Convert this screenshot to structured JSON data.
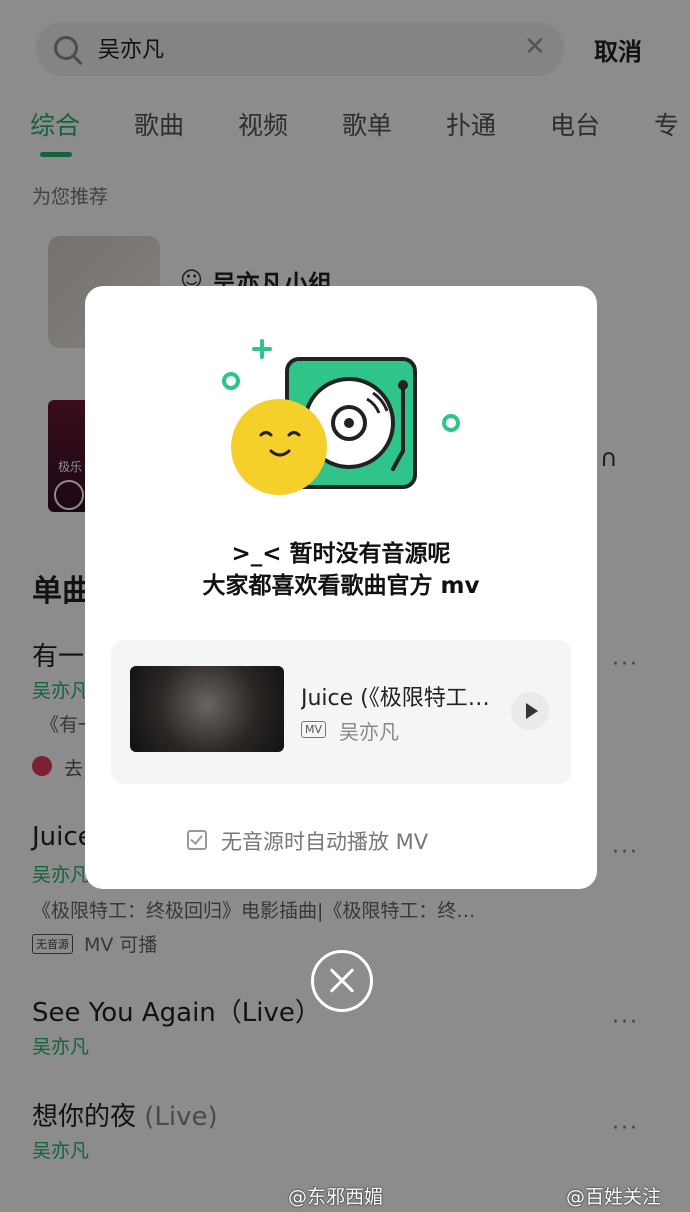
{
  "search": {
    "query": "吴亦凡",
    "cancel_label": "取消"
  },
  "tabs": [
    "综合",
    "歌曲",
    "视频",
    "歌单",
    "扑通",
    "电台",
    "专"
  ],
  "recommend": {
    "title": "为您推荐",
    "group_name": "吴亦凡小组",
    "thumb_text": "极乐"
  },
  "songs_section": {
    "title": "单曲"
  },
  "songs": [
    {
      "title": "有一",
      "artist": "吴亦凡",
      "sub": "《有一",
      "goto": "去"
    },
    {
      "title": "Juice",
      "artist": "吴亦凡",
      "sub": "《极限特工：终极回归》电影插曲|《极限特工：终…",
      "tag": "无音源",
      "tag_text": "MV 可播"
    },
    {
      "title": "See You Again（Live）",
      "artist": "吴亦凡"
    },
    {
      "title": "想你的夜",
      "title_suffix": "(Live)",
      "artist": "吴亦凡"
    }
  ],
  "more_label": "···",
  "modal": {
    "line1": ">_< 暂时没有音源呢",
    "line2": "大家都喜欢看歌曲官方 mv",
    "mv": {
      "title": "Juice (《极限特工：终极回归》电影插曲)",
      "tag": "MV",
      "artist": "吴亦凡"
    },
    "checkbox_label": "无音源时自动播放 MV"
  },
  "watermarks": [
    "@东邪西媚",
    "@百姓关注"
  ],
  "colors": {
    "accent": "#21b66a",
    "illustration_green": "#2ec48a",
    "sun_yellow": "#f6d02a"
  },
  "icons": [
    "search-icon",
    "clear-icon",
    "chat-icon",
    "headphone-icon",
    "more-icon",
    "play-icon",
    "checkbox-icon",
    "close-icon",
    "weibo-icon"
  ]
}
